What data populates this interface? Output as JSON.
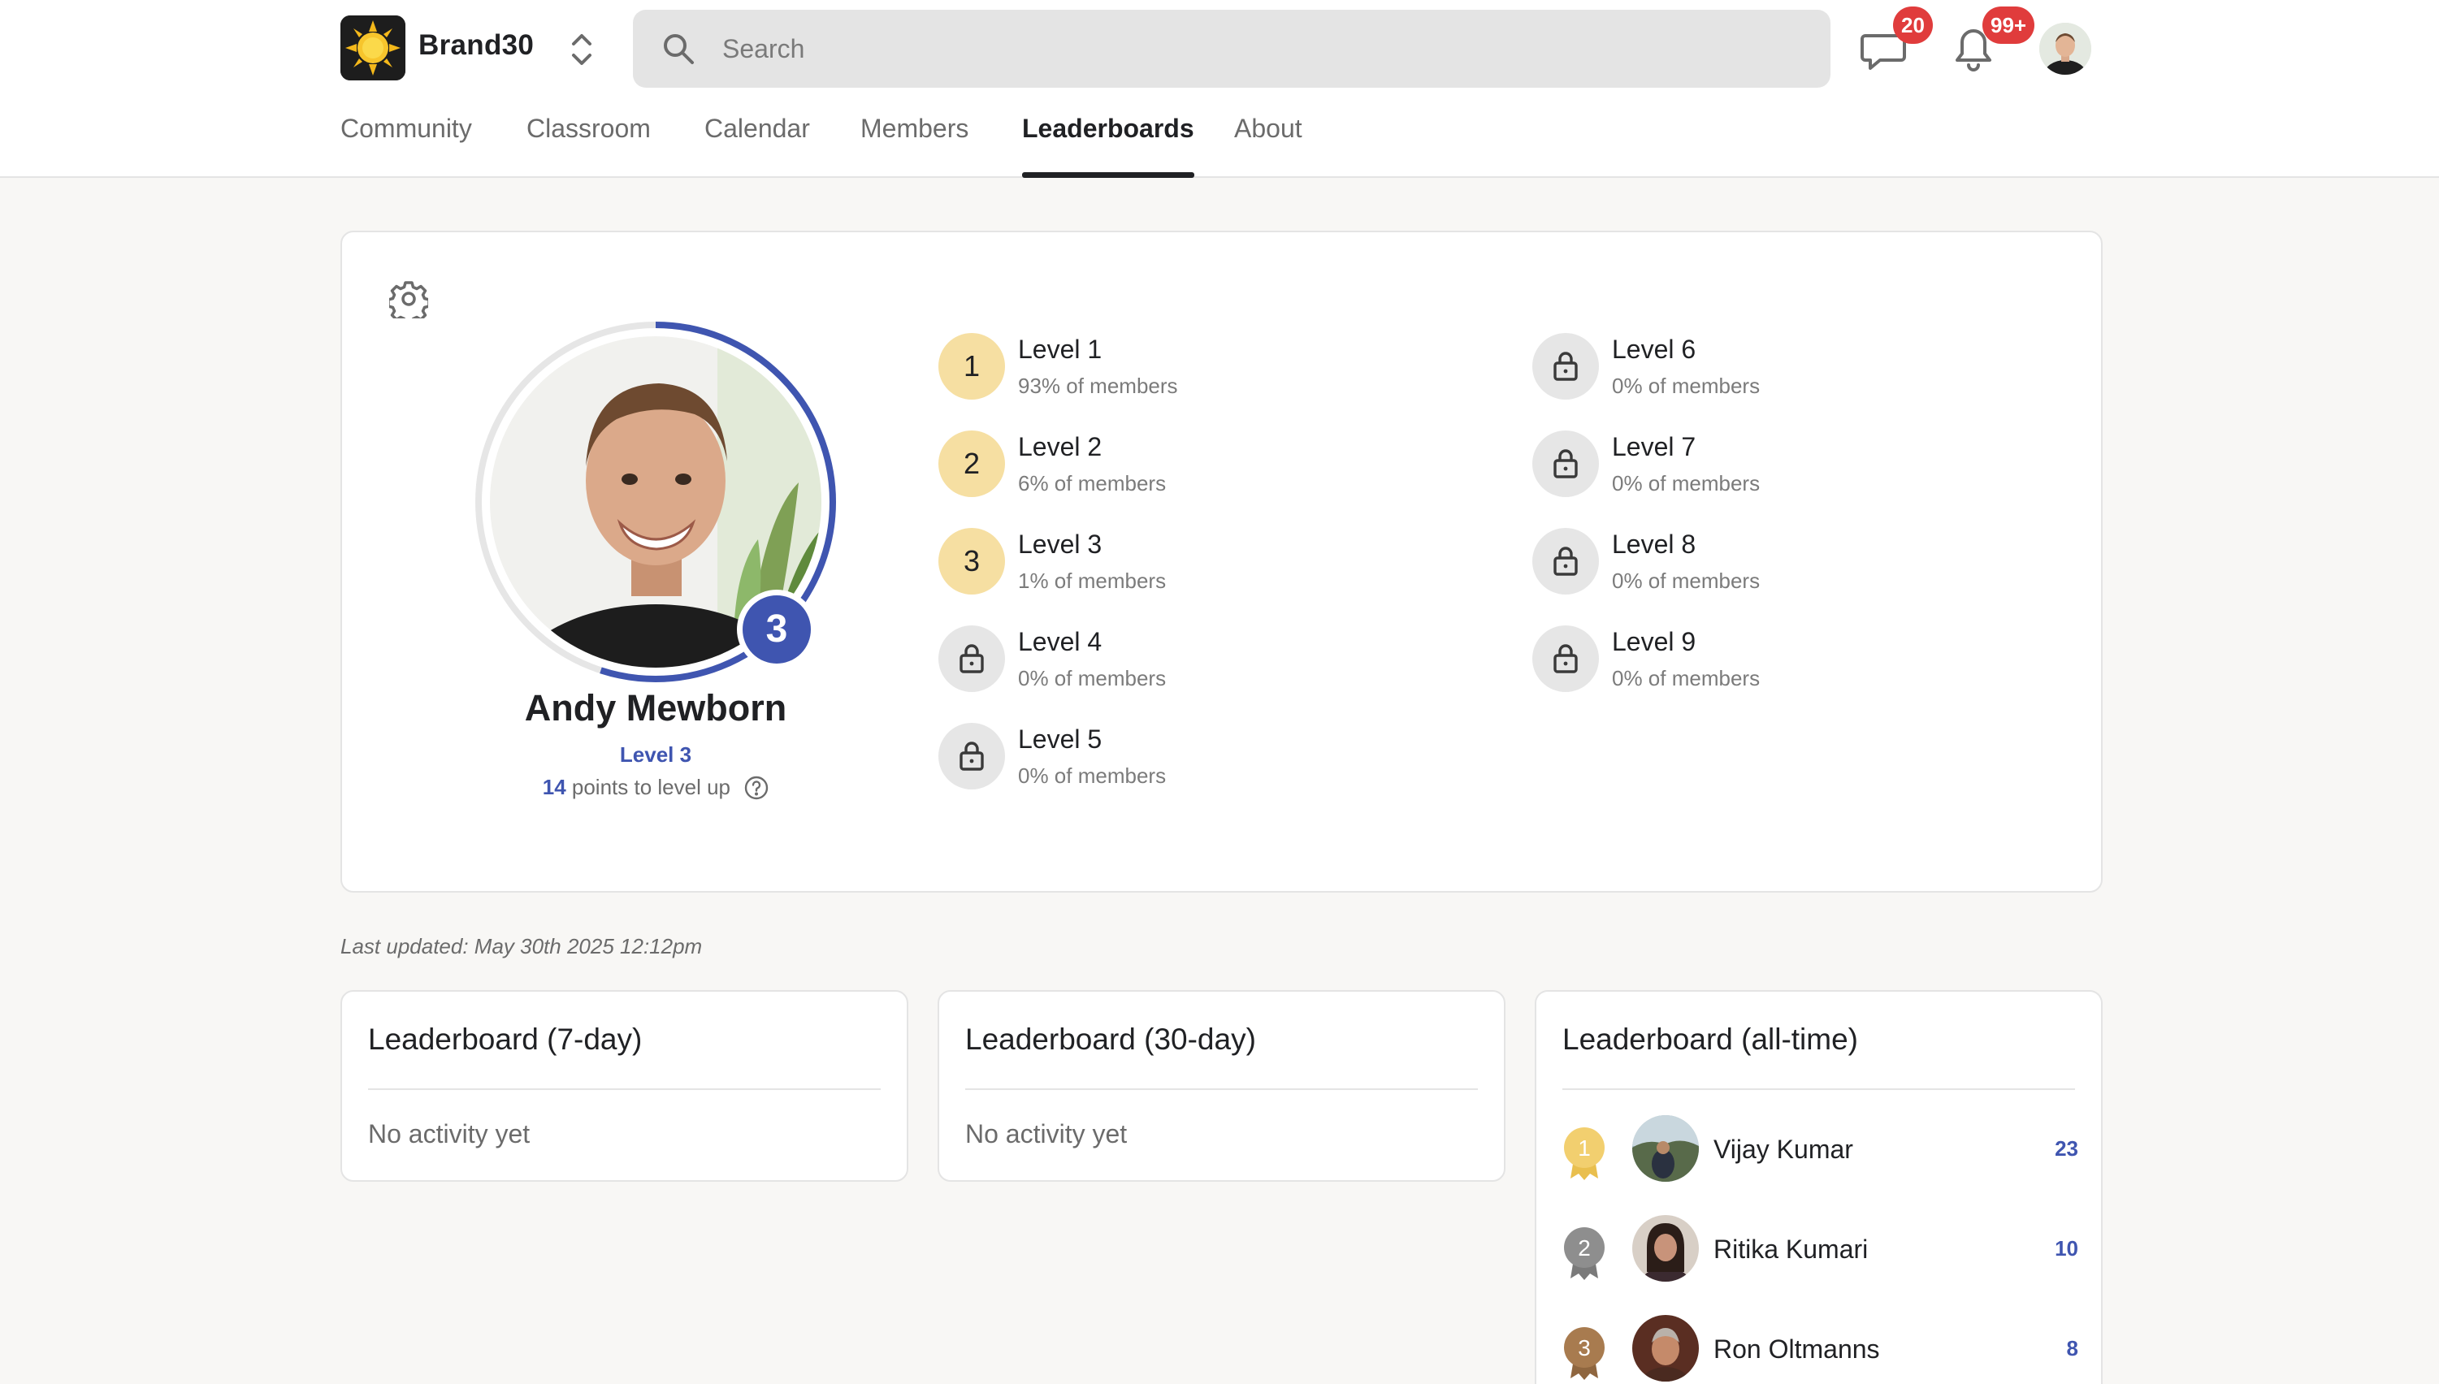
{
  "brand": {
    "name": "Brand30"
  },
  "search": {
    "placeholder": "Search"
  },
  "notifications": {
    "chat_count": "20",
    "bell_count": "99+"
  },
  "nav": {
    "tabs": [
      {
        "label": "Community",
        "active": false
      },
      {
        "label": "Classroom",
        "active": false
      },
      {
        "label": "Calendar",
        "active": false
      },
      {
        "label": "Members",
        "active": false
      },
      {
        "label": "Leaderboards",
        "active": true
      },
      {
        "label": "About",
        "active": false
      }
    ]
  },
  "profile": {
    "name": "Andy Mewborn",
    "level_label": "Level 3",
    "level_number": "3",
    "points_value": "14",
    "points_text": "points to level up",
    "level_progress": 0.55
  },
  "levels": [
    {
      "number": "1",
      "title": "Level 1",
      "members": "93% of members",
      "locked": false
    },
    {
      "number": "2",
      "title": "Level 2",
      "members": "6% of members",
      "locked": false
    },
    {
      "number": "3",
      "title": "Level 3",
      "members": "1% of members",
      "locked": false
    },
    {
      "number": "4",
      "title": "Level 4",
      "members": "0% of members",
      "locked": true
    },
    {
      "number": "5",
      "title": "Level 5",
      "members": "0% of members",
      "locked": true
    },
    {
      "number": "6",
      "title": "Level 6",
      "members": "0% of members",
      "locked": true
    },
    {
      "number": "7",
      "title": "Level 7",
      "members": "0% of members",
      "locked": true
    },
    {
      "number": "8",
      "title": "Level 8",
      "members": "0% of members",
      "locked": true
    },
    {
      "number": "9",
      "title": "Level 9",
      "members": "0% of members",
      "locked": true
    }
  ],
  "last_updated": "Last updated: May 30th 2025 12:12pm",
  "leaderboards": {
    "seven_day": {
      "title": "Leaderboard (7-day)",
      "empty": "No activity yet"
    },
    "thirty_day": {
      "title": "Leaderboard (30-day)",
      "empty": "No activity yet"
    },
    "all_time": {
      "title": "Leaderboard (all-time)",
      "entries": [
        {
          "rank": "1",
          "name": "Vijay Kumar",
          "points": "23"
        },
        {
          "rank": "2",
          "name": "Ritika Kumari",
          "points": "10"
        },
        {
          "rank": "3",
          "name": "Ron Oltmanns",
          "points": "8"
        }
      ]
    }
  },
  "colors": {
    "accent": "#3f55b0",
    "gold": "#f2cf6f",
    "silver": "#8e8e8e",
    "bronze": "#a87b4f",
    "badge": "#e03c3c",
    "level_unlocked": "#f6dfa2"
  }
}
